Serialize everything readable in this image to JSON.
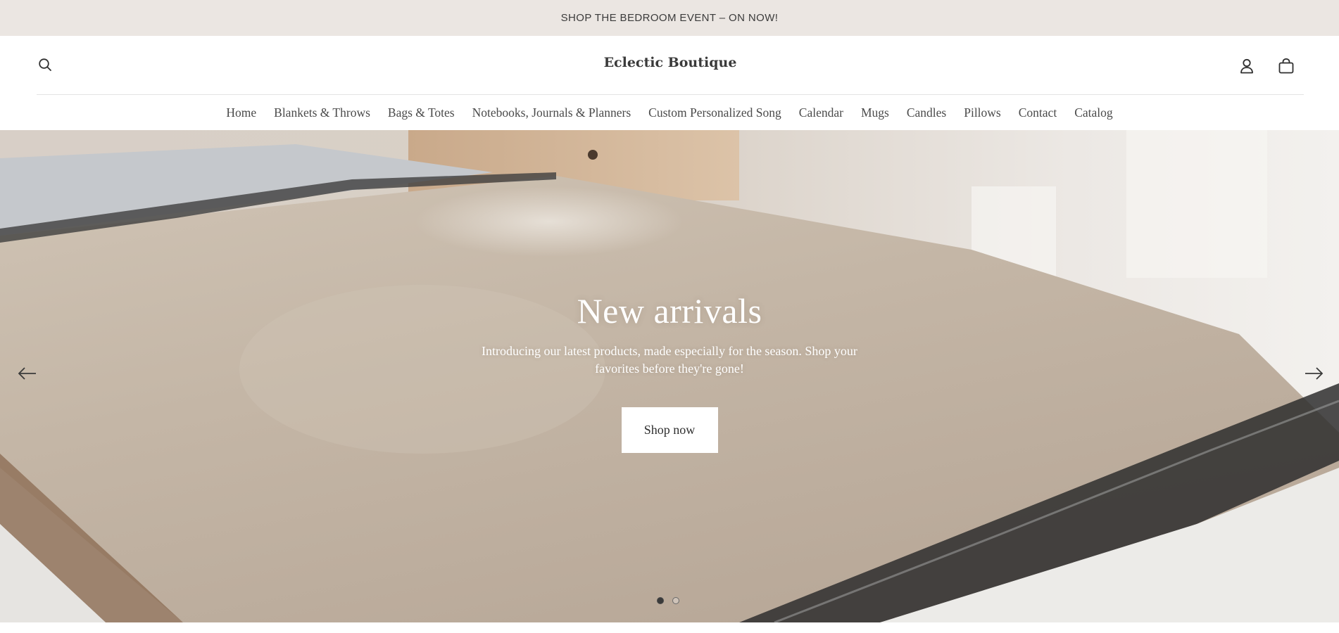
{
  "announcement": {
    "text": "SHOP THE BEDROOM EVENT – ON NOW!"
  },
  "header": {
    "brand": "Eclectic Boutique",
    "icons": {
      "search": "search-icon",
      "account": "account-icon",
      "cart": "cart-icon"
    }
  },
  "nav": {
    "items": [
      {
        "label": "Home"
      },
      {
        "label": "Blankets & Throws"
      },
      {
        "label": "Bags & Totes"
      },
      {
        "label": "Notebooks, Journals & Planners"
      },
      {
        "label": "Custom Personalized Song"
      },
      {
        "label": "Calendar"
      },
      {
        "label": "Mugs"
      },
      {
        "label": "Candles"
      },
      {
        "label": "Pillows"
      },
      {
        "label": "Contact"
      },
      {
        "label": "Catalog"
      }
    ]
  },
  "hero": {
    "title": "New arrivals",
    "subtitle": "Introducing our latest products, made especially for the season. Shop your favorites before they're gone!",
    "button_label": "Shop now",
    "slide_count": 2,
    "active_slide": 1
  },
  "colors": {
    "announcement_bg": "#ebe6e2",
    "text": "#3a3a3a",
    "hero_text": "#ffffff",
    "button_bg": "#ffffff"
  }
}
